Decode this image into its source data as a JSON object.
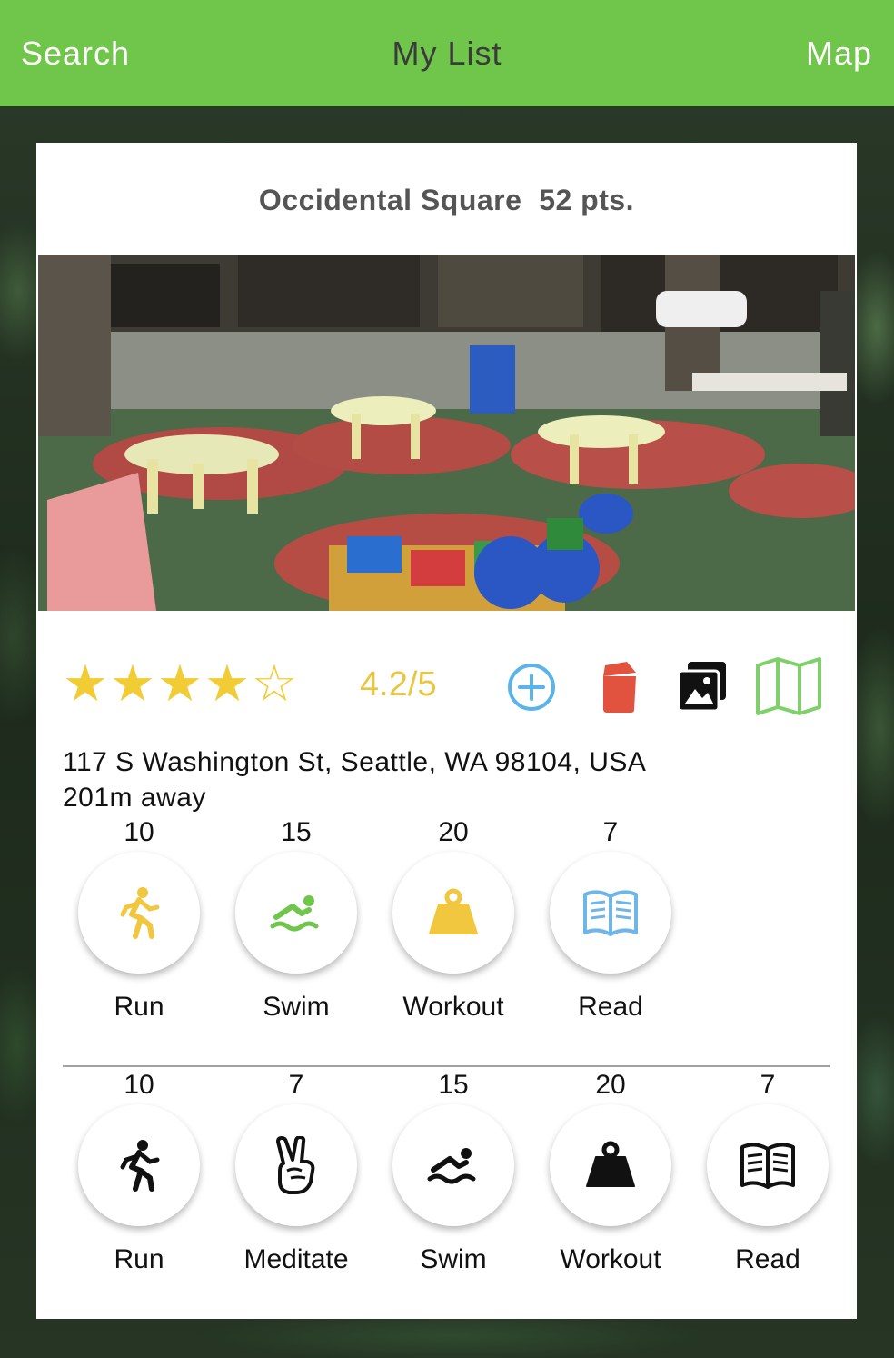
{
  "nav": {
    "left": "Search",
    "title": "My List",
    "right": "Map"
  },
  "place": {
    "name": "Occidental Square",
    "points": "52 pts.",
    "rating_value": 4.2,
    "rating_text": "4.2/5",
    "stars_filled": 4,
    "stars_total": 5,
    "address": "117 S Washington St, Seattle, WA 98104, USA",
    "distance": "201m away"
  },
  "actions": {
    "add_icon": "plus-circle-icon",
    "delete_icon": "trash-icon",
    "photos_icon": "photos-icon",
    "map_icon": "map-icon"
  },
  "activities_colored": [
    {
      "points": "10",
      "label": "Run",
      "icon": "run-icon",
      "color": "#f1c73f"
    },
    {
      "points": "15",
      "label": "Swim",
      "icon": "swim-icon",
      "color": "#6fc64a"
    },
    {
      "points": "20",
      "label": "Workout",
      "icon": "weight-icon",
      "color": "#f1c73f"
    },
    {
      "points": "7",
      "label": "Read",
      "icon": "book-icon",
      "color": "#6fb6e6"
    }
  ],
  "activities_all": [
    {
      "points": "10",
      "label": "Run",
      "icon": "run-icon"
    },
    {
      "points": "7",
      "label": "Meditate",
      "icon": "peace-hand-icon"
    },
    {
      "points": "15",
      "label": "Swim",
      "icon": "swim-icon"
    },
    {
      "points": "20",
      "label": "Workout",
      "icon": "weight-icon"
    },
    {
      "points": "7",
      "label": "Read",
      "icon": "book-icon"
    }
  ],
  "colors": {
    "header": "#6fc64a",
    "star": "#f2cc34",
    "add": "#5ab4ea",
    "delete": "#e2533f",
    "map": "#7fd06a"
  }
}
